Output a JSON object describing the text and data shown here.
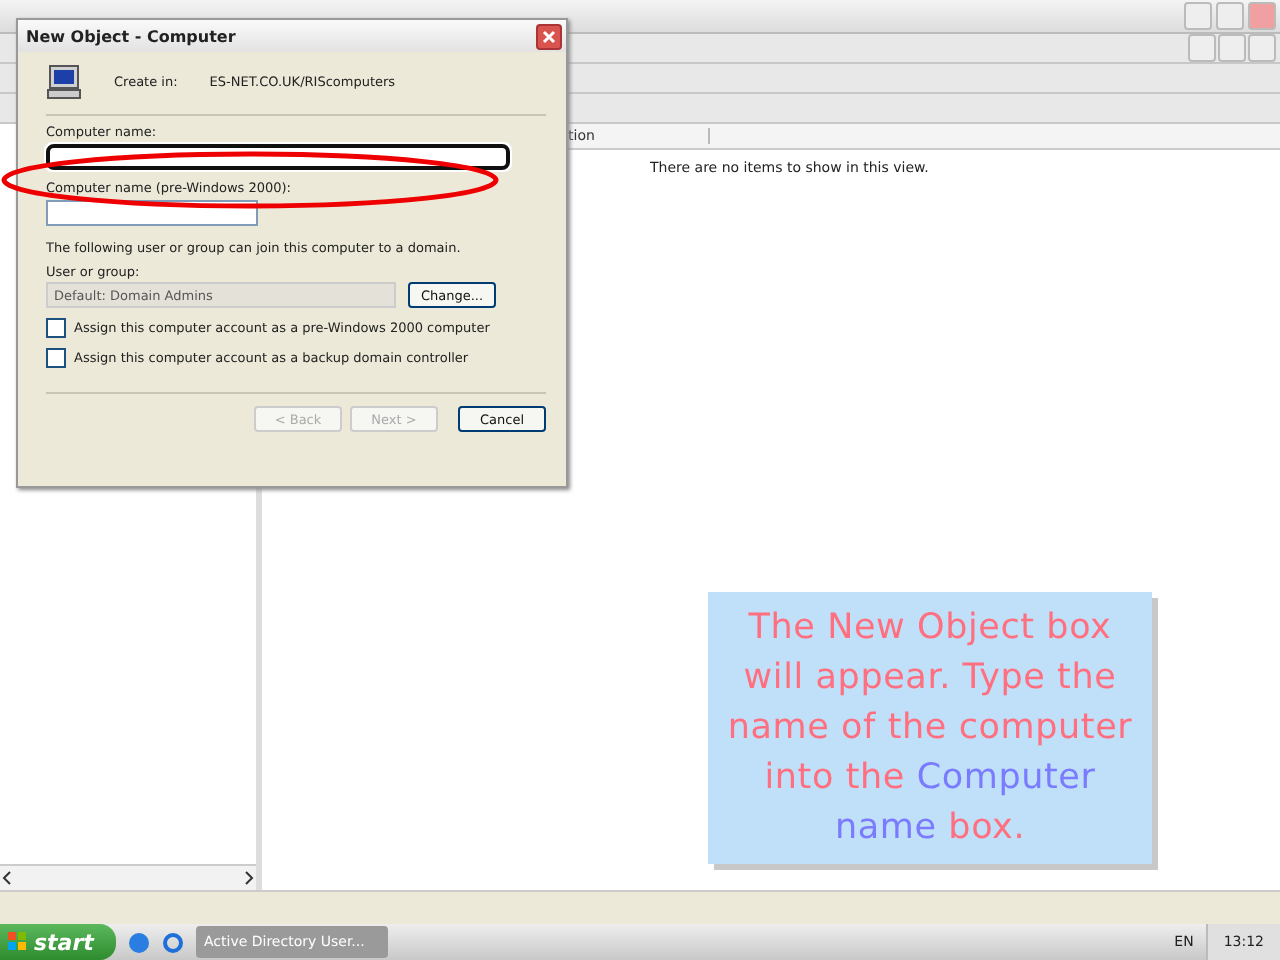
{
  "main_window": {
    "column_header": "tion",
    "empty_message": "There are no items to show in this view."
  },
  "dialog": {
    "title": "New Object - Computer",
    "create_in_label": "Create in:",
    "create_in_path": "ES-NET.CO.UK/RIScomputers",
    "computer_name_label": "Computer name:",
    "pre2000_label": "Computer name (pre-Windows 2000):",
    "join_text": "The following user or group can join this computer to a domain.",
    "user_group_label": "User or group:",
    "user_group_value": "Default: Domain Admins",
    "change_button": "Change...",
    "checkboxes": [
      {
        "label": "Assign this computer account as a pre-Windows 2000 computer",
        "checked": false
      },
      {
        "label": "Assign this computer account as a backup domain controller",
        "checked": false
      }
    ],
    "buttons": [
      {
        "label": "< Back",
        "disabled": true
      },
      {
        "label": "Next >",
        "disabled": true
      },
      {
        "label": "Cancel",
        "disabled": false
      }
    ]
  },
  "callout": {
    "parts": [
      {
        "text": "The New Object box will appear. Type the name of the computer into the",
        "kind": "normal"
      },
      {
        "text": "Computer name",
        "kind": "highlight"
      },
      {
        "text": "box.",
        "kind": "normal"
      }
    ]
  },
  "taskbar": {
    "start": "start",
    "task": "Active Directory User...",
    "language": "EN",
    "clock": "13:12"
  }
}
